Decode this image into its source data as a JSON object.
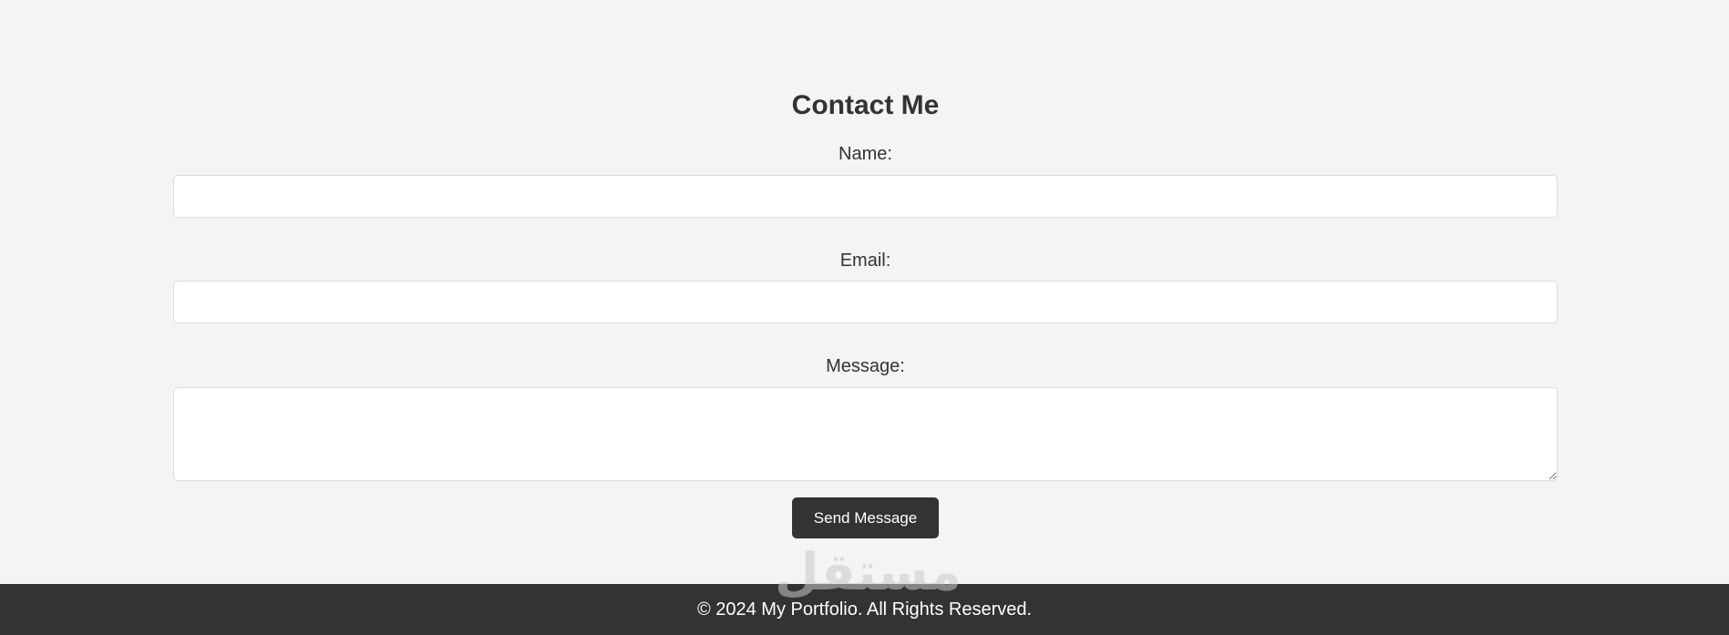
{
  "contact": {
    "title": "Contact Me",
    "name_label": "Name:",
    "name_value": "",
    "email_label": "Email:",
    "email_value": "",
    "message_label": "Message:",
    "message_value": "",
    "submit_label": "Send Message"
  },
  "watermark": {
    "text": "مستقل"
  },
  "footer": {
    "copyright": "© 2024 My Portfolio. All Rights Reserved."
  },
  "colors": {
    "page_background": "#f4f4f4",
    "button_background": "#333333",
    "footer_background": "#333333",
    "text": "#333333"
  }
}
